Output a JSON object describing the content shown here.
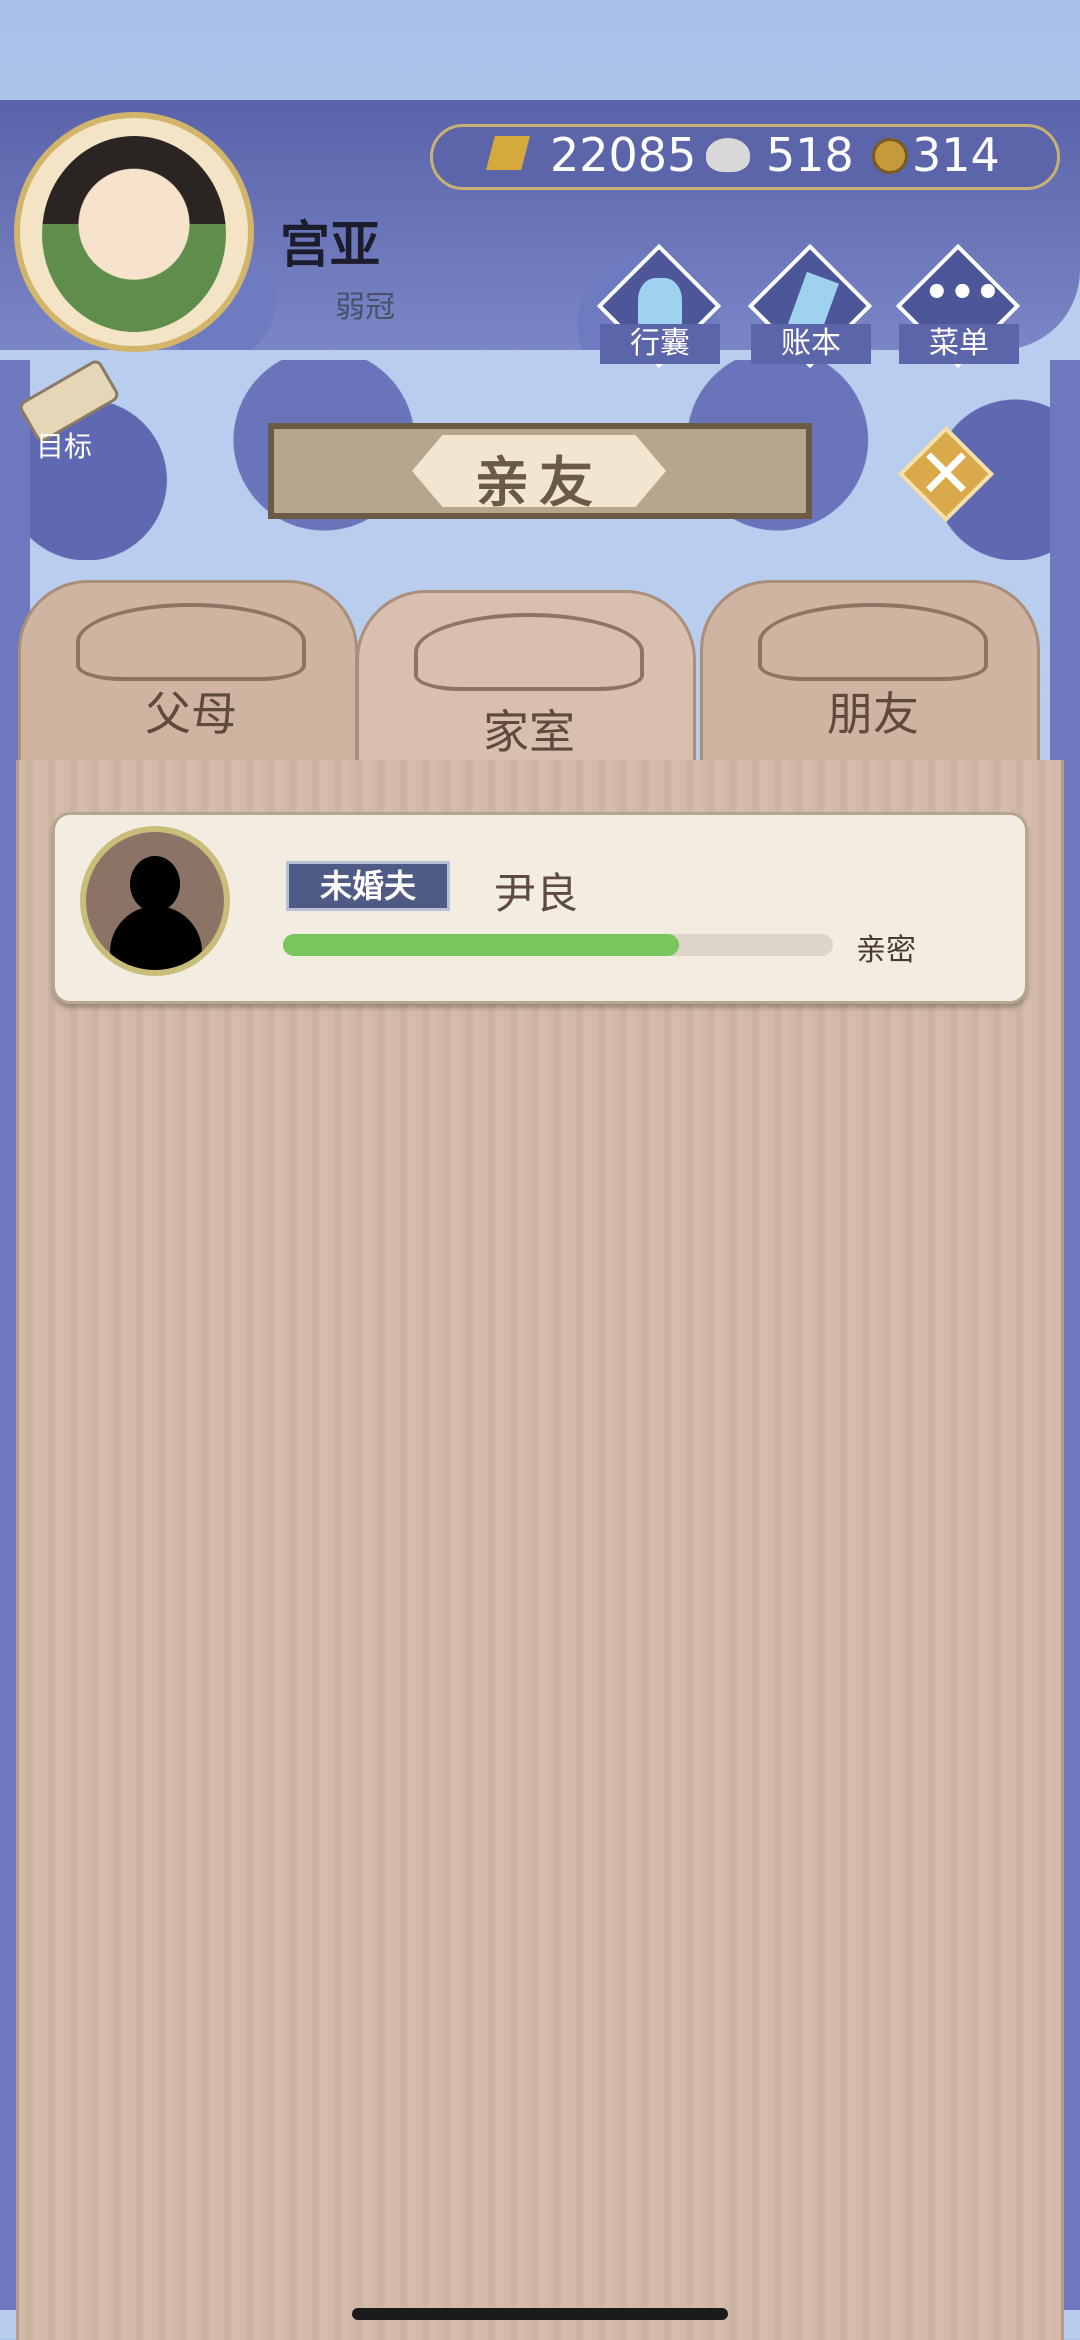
{
  "player": {
    "name": "宫亚",
    "title": "弱冠"
  },
  "currency": {
    "gold": "22085",
    "silver": "518",
    "coins": "314"
  },
  "menu": {
    "bag": "行囊",
    "ledger": "账本",
    "menu": "菜单",
    "goal": "目标"
  },
  "page": {
    "title": "亲友",
    "close_icon": "close-icon"
  },
  "tabs": [
    {
      "label": "父母",
      "active": false
    },
    {
      "label": "家室",
      "active": true
    },
    {
      "label": "朋友",
      "active": false
    }
  ],
  "members": [
    {
      "relation": "未婚夫",
      "name": "尹良",
      "intimacy_label": "亲密",
      "intimacy": 0.72
    }
  ],
  "colors": {
    "accent": "#5c64aa",
    "bar": "#79c75c",
    "panel": "#d2b8a6"
  }
}
